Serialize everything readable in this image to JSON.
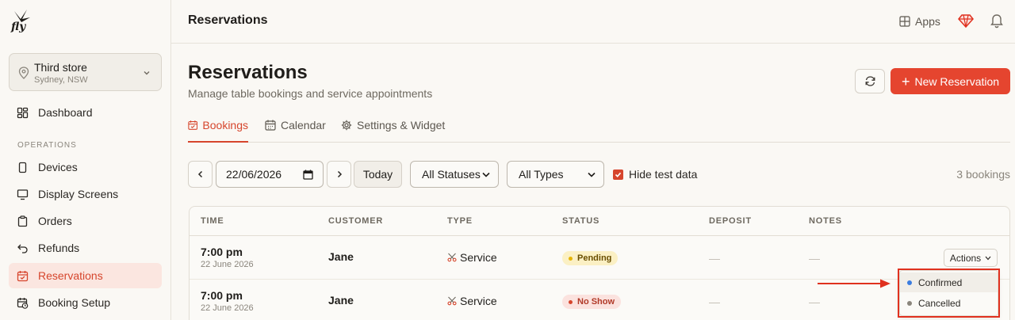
{
  "brand": {
    "logo_text": "fly",
    "accent": "#e5452f"
  },
  "store": {
    "name": "Third store",
    "location": "Sydney, NSW"
  },
  "sidebar": {
    "items_top": [
      {
        "label": "Dashboard",
        "icon": "grid-icon"
      }
    ],
    "section_label": "OPERATIONS",
    "items": [
      {
        "label": "Devices",
        "icon": "device-icon"
      },
      {
        "label": "Display Screens",
        "icon": "display-icon"
      },
      {
        "label": "Orders",
        "icon": "clipboard-icon"
      },
      {
        "label": "Refunds",
        "icon": "undo-icon"
      },
      {
        "label": "Reservations",
        "icon": "calendar-icon",
        "active": true
      },
      {
        "label": "Booking Setup",
        "icon": "calendar-clock-icon"
      }
    ]
  },
  "topbar": {
    "title": "Reservations",
    "apps_label": "Apps"
  },
  "page": {
    "title": "Reservations",
    "subtitle": "Manage table bookings and service appointments",
    "new_button": "New Reservation"
  },
  "tabs": [
    {
      "label": "Bookings",
      "active": true
    },
    {
      "label": "Calendar"
    },
    {
      "label": "Settings & Widget"
    }
  ],
  "filters": {
    "date": "22/06/2026",
    "today_label": "Today",
    "status_selected": "All Statuses",
    "type_selected": "All Types",
    "hide_test_label": "Hide test data",
    "hide_test_checked": true,
    "count_text": "3 bookings"
  },
  "table": {
    "columns": [
      "TIME",
      "CUSTOMER",
      "TYPE",
      "STATUS",
      "DEPOSIT",
      "NOTES"
    ],
    "rows": [
      {
        "time": "7:00 pm",
        "date": "22 June 2026",
        "customer": "Jane",
        "type": "Service",
        "status": "Pending",
        "deposit": "—",
        "notes": "—",
        "actions": "Actions"
      },
      {
        "time": "7:00 pm",
        "date": "22 June 2026",
        "customer": "Jane",
        "type": "Service",
        "status": "No Show",
        "deposit": "—",
        "notes": "—"
      }
    ]
  },
  "dropdown": {
    "items": [
      {
        "label": "Confirmed",
        "color": "#3b7de0"
      },
      {
        "label": "Cancelled",
        "color": "#8a857c"
      }
    ]
  },
  "annotation": {
    "color": "#e0311f"
  }
}
